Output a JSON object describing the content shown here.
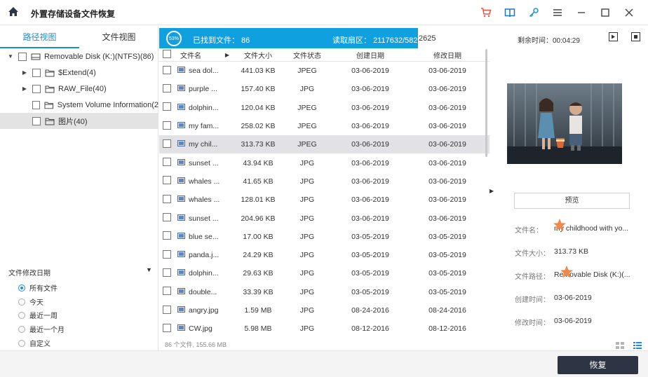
{
  "app": {
    "title": "外置存储设备文件恢复"
  },
  "titlebar": {
    "icons": [
      "home-icon",
      "cart-icon",
      "book-icon",
      "key-icon",
      "menu-icon",
      "minimize-icon",
      "maximize-icon",
      "close-icon"
    ]
  },
  "view_tabs": [
    "路径视图",
    "文件视图"
  ],
  "tree": [
    {
      "label": "Removable Disk (K:)(NTFS)(86)",
      "level": 0,
      "expanded": true,
      "icon": "drive-icon"
    },
    {
      "label": "$Extend(4)",
      "level": 1,
      "expanded": false,
      "icon": "folder-icon"
    },
    {
      "label": "RAW_File(40)",
      "level": 1,
      "expanded": false,
      "icon": "folder-icon"
    },
    {
      "label": "System Volume Information(2",
      "level": 1,
      "expanded": null,
      "icon": "folder-icon"
    },
    {
      "label": "图片(40)",
      "level": 1,
      "expanded": null,
      "icon": "folder-icon",
      "selected": true
    }
  ],
  "filter": {
    "title": "文件修改日期",
    "options": [
      "所有文件",
      "今天",
      "最近一周",
      "最近一个月",
      "自定义"
    ],
    "selected_index": 0
  },
  "scan": {
    "percent_label": "53%",
    "percent": 53,
    "found": "已找到文件：  86",
    "sector": "读取扇区：  2117632/5827",
    "sector_tail": "2625",
    "remaining": "剩余时间：00:04:29"
  },
  "table": {
    "headers": [
      "文件名",
      "文件大小",
      "文件状态",
      "创建日期",
      "修改日期"
    ],
    "rows": [
      {
        "name": "sea dol...",
        "size": "441.03  KB",
        "type": "JPEG",
        "created": "03-06-2019",
        "modified": "03-06-2019"
      },
      {
        "name": "purple ...",
        "size": "157.40  KB",
        "type": "JPG",
        "created": "03-06-2019",
        "modified": "03-06-2019"
      },
      {
        "name": "dolphin...",
        "size": "120.04  KB",
        "type": "JPEG",
        "created": "03-06-2019",
        "modified": "03-06-2019"
      },
      {
        "name": "my fam...",
        "size": "258.02  KB",
        "type": "JPEG",
        "created": "03-06-2019",
        "modified": "03-06-2019"
      },
      {
        "name": "my chil...",
        "size": "313.73  KB",
        "type": "JPEG",
        "created": "03-06-2019",
        "modified": "03-06-2019",
        "selected": true
      },
      {
        "name": "sunset ...",
        "size": "43.94  KB",
        "type": "JPG",
        "created": "03-06-2019",
        "modified": "03-06-2019"
      },
      {
        "name": "whales ...",
        "size": "41.65  KB",
        "type": "JPG",
        "created": "03-06-2019",
        "modified": "03-06-2019"
      },
      {
        "name": "whales ...",
        "size": "128.01  KB",
        "type": "JPG",
        "created": "03-06-2019",
        "modified": "03-06-2019"
      },
      {
        "name": "sunset ...",
        "size": "204.96  KB",
        "type": "JPG",
        "created": "03-06-2019",
        "modified": "03-06-2019"
      },
      {
        "name": "blue se...",
        "size": "17.00  KB",
        "type": "JPG",
        "created": "03-05-2019",
        "modified": "03-05-2019"
      },
      {
        "name": "panda.j...",
        "size": "24.29  KB",
        "type": "JPG",
        "created": "03-05-2019",
        "modified": "03-05-2019"
      },
      {
        "name": "dolphin...",
        "size": "29.63  KB",
        "type": "JPG",
        "created": "03-05-2019",
        "modified": "03-05-2019"
      },
      {
        "name": "double...",
        "size": "33.39  KB",
        "type": "JPG",
        "created": "03-05-2019",
        "modified": "03-05-2019"
      },
      {
        "name": "angry.jpg",
        "size": "1.59  MB",
        "type": "JPG",
        "created": "08-24-2016",
        "modified": "08-24-2016"
      },
      {
        "name": "CW.jpg",
        "size": "5.98  MB",
        "type": "JPG",
        "created": "08-12-2016",
        "modified": "08-12-2016"
      }
    ],
    "footer": "86 个文件, 155.66  MB"
  },
  "preview": {
    "button": "预览",
    "labels": {
      "name": "文件名：",
      "size": "文件大小：",
      "path": "文件路径：",
      "created": "创建时间：",
      "modified": "修改时间："
    },
    "values": {
      "name": "my childhood with yo...",
      "size": "313.73  KB",
      "path": "Removable Disk (K:)(...",
      "created": "03-06-2019",
      "modified": "03-06-2019"
    }
  },
  "actions": {
    "recover": "恢复"
  },
  "colors": {
    "accent": "#1a8fd8",
    "progress": "#0fa0e0",
    "recover_bg": "#2d3444",
    "cart": "#e8533d"
  }
}
